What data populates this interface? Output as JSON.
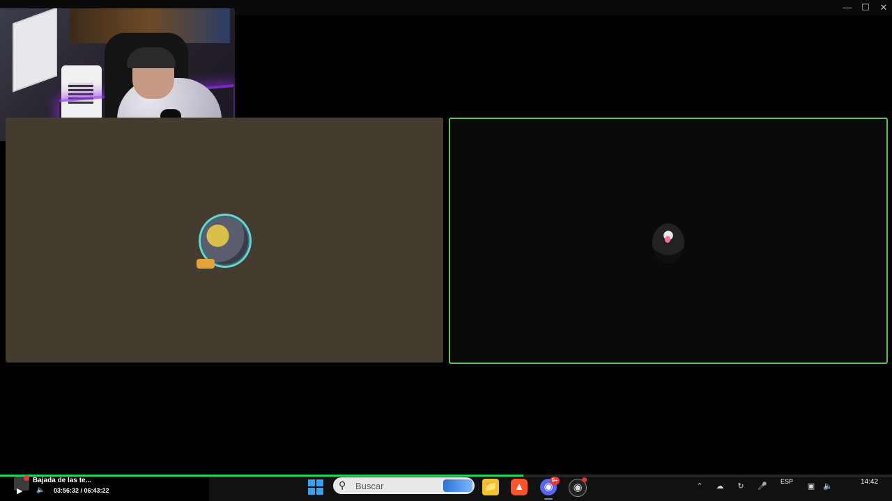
{
  "window": {
    "minimize_glyph": "—",
    "maximize_glyph": "☐",
    "close_glyph": "✕"
  },
  "media": {
    "title": "Bajada de las te...",
    "time": "03:56:32 / 06:43:22",
    "progress_fraction": 0.5864,
    "play_glyph": "▶",
    "volume_glyph": "🔈"
  },
  "taskbar": {
    "search_placeholder": "Buscar",
    "discord_badge": "9+",
    "language": "ESP",
    "clock": "14:42"
  },
  "colors": {
    "progress": "#1ed760",
    "panel_left": "#433c2f",
    "panel_right_border": "#5ec05a"
  },
  "icons": {
    "start": "windows-start-icon",
    "search": "search-icon",
    "files": "file-explorer-icon",
    "brave": "brave-browser-icon",
    "discord": "discord-icon",
    "obs": "obs-icon"
  }
}
